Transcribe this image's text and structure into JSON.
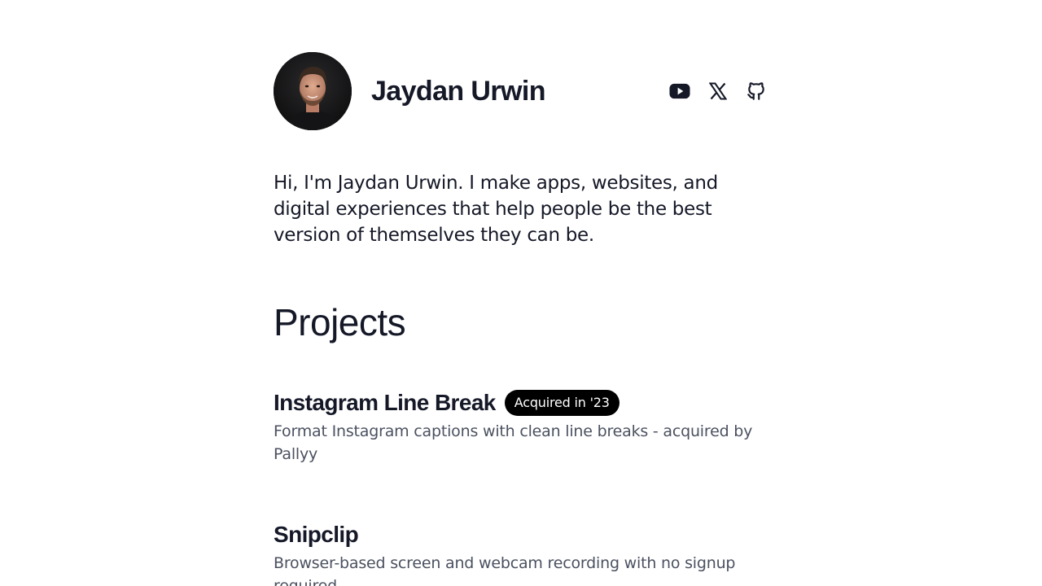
{
  "profile": {
    "name": "Jaydan Urwin",
    "intro": "Hi, I'm Jaydan Urwin. I make apps, websites, and digital experiences that help people be the best version of themselves they can be."
  },
  "socials": [
    {
      "icon": "youtube-icon"
    },
    {
      "icon": "x-icon"
    },
    {
      "icon": "github-icon"
    }
  ],
  "projects_heading": "Projects",
  "projects": [
    {
      "title": "Instagram Line Break",
      "badge": "Acquired in '23",
      "description": "Format Instagram captions with clean line breaks - acquired by Pallyy"
    },
    {
      "title": "Snipclip",
      "description": "Browser-based screen and webcam recording with no signup required"
    }
  ],
  "colors": {
    "text": "#151827",
    "muted": "#4b5160",
    "badge_bg": "#000000",
    "badge_text": "#ffffff"
  }
}
